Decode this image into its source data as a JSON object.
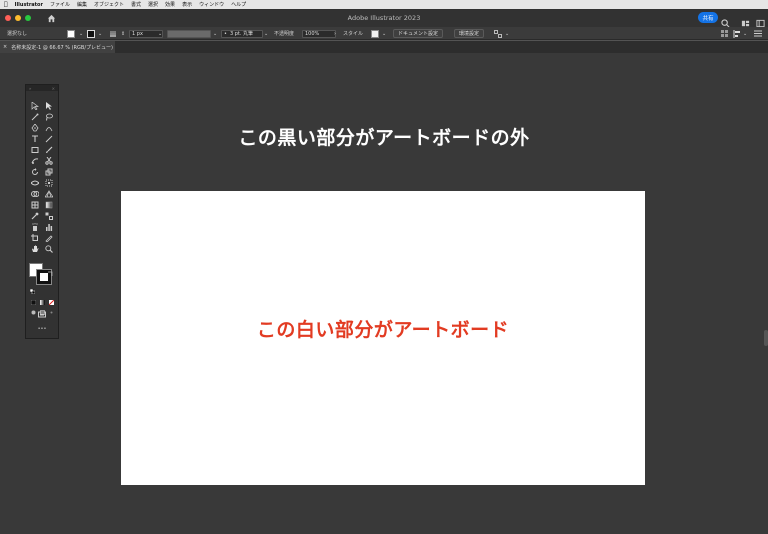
{
  "menubar": {
    "app_name": "Illustrator",
    "items": [
      "ファイル",
      "編集",
      "オブジェクト",
      "書式",
      "選択",
      "効果",
      "表示",
      "ウィンドウ",
      "ヘルプ"
    ]
  },
  "window": {
    "title": "Adobe Illustrator 2023",
    "share_label": "共有",
    "traffic_colors": [
      "#ff5f57",
      "#febc2e",
      "#28c840"
    ]
  },
  "controlbar": {
    "selection_label": "選択なし",
    "stroke_weight": "1 px",
    "brush_label": "3 pt. 丸筆",
    "opacity_label": "不透明度",
    "opacity_value": "100%",
    "style_label": "スタイル",
    "doc_setup_button": "ドキュメント設定",
    "preferences_button": "環境設定"
  },
  "document_tab": {
    "close_glyph": "×",
    "label": "名称未設定-1 @ 66.67 % (RGB/プレビュー)"
  },
  "canvas": {
    "outside_text": "この黒い部分がアートボードの外",
    "artboard_text": "この白い部分がアートボード",
    "outside_text_color": "#ffffff",
    "artboard_text_color": "#e23b22"
  },
  "tools": {
    "more_glyph": "•••"
  }
}
